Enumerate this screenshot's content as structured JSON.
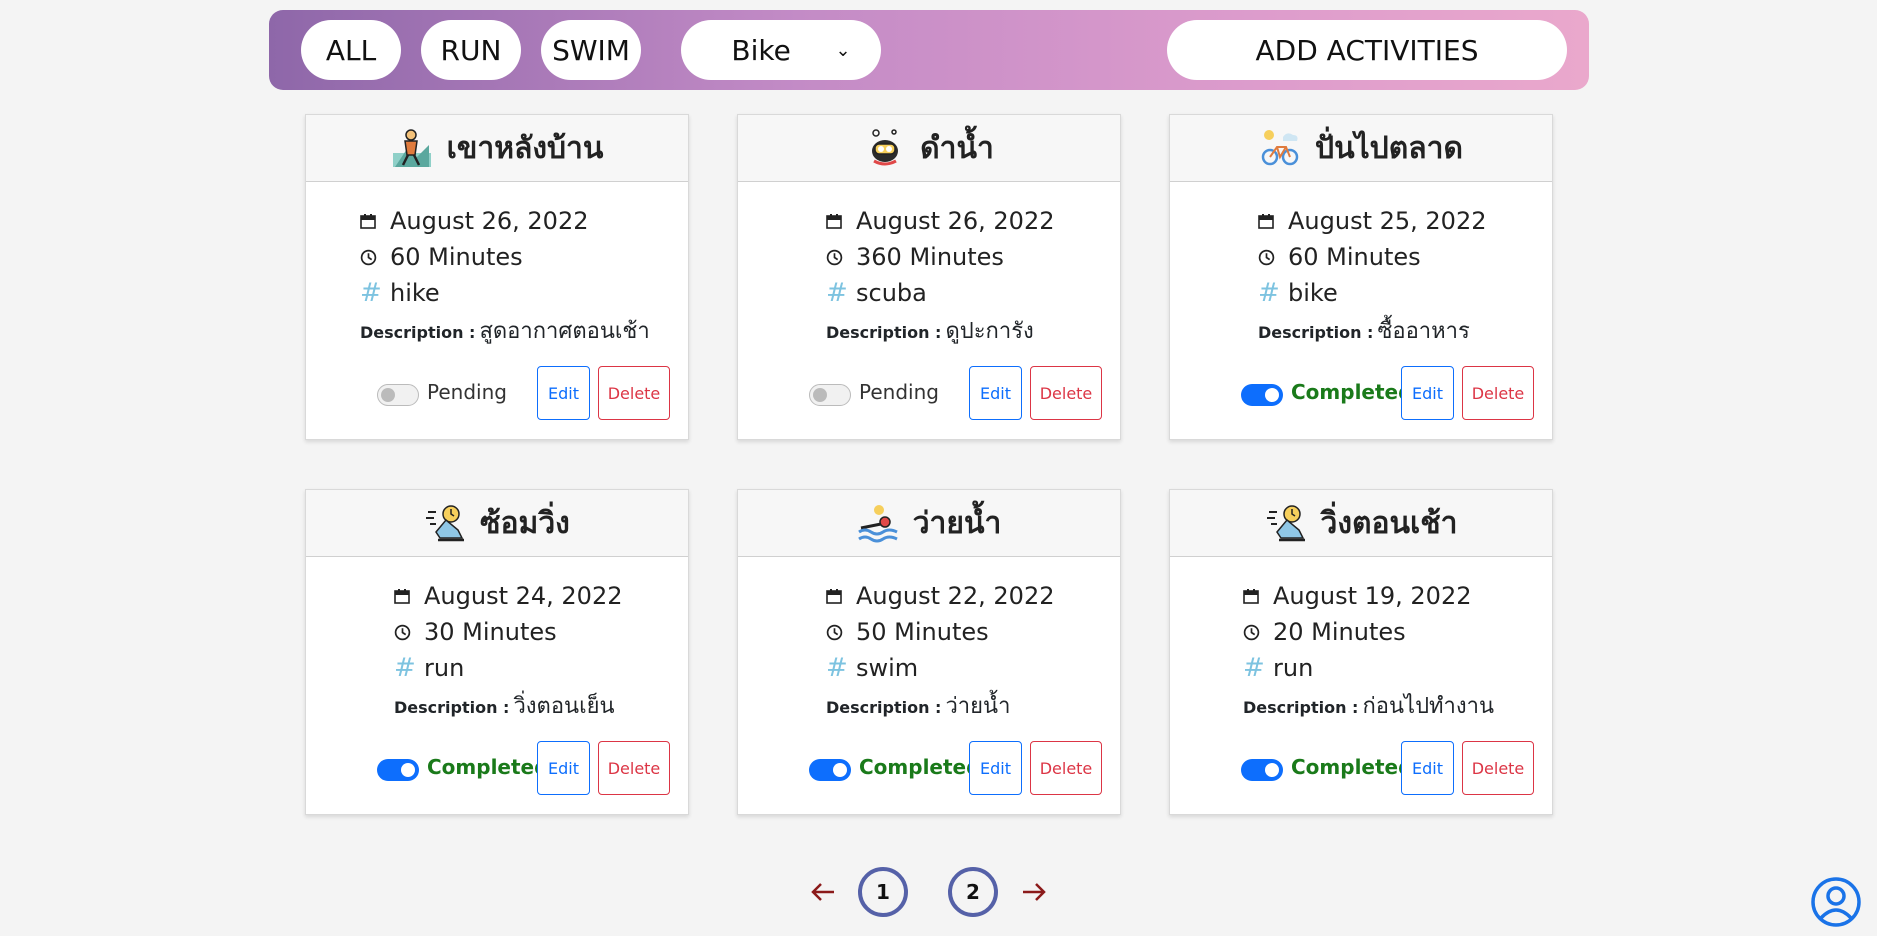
{
  "filters": {
    "all": "ALL",
    "run": "RUN",
    "swim": "SWIM",
    "select_value": "Bike",
    "add": "ADD ACTIVITIES"
  },
  "description_label": "Description :",
  "actions": {
    "edit": "Edit",
    "delete": "Delete"
  },
  "cards": [
    {
      "title": "เขาหลังบ้าน",
      "icon": "hiking-icon",
      "date": "August 26, 2022",
      "duration": "60 Minutes",
      "tag": "hike",
      "description": "สูดอากาศตอนเช้า",
      "status": "Pending",
      "completed": false
    },
    {
      "title": "ดำน้ำ",
      "icon": "scuba-diving-icon",
      "date": "August 26, 2022",
      "duration": "360 Minutes",
      "tag": "scuba",
      "description": "ดูปะการัง",
      "status": "Pending",
      "completed": false
    },
    {
      "title": "ปั่นไปตลาด",
      "icon": "bike-icon",
      "date": "August 25, 2022",
      "duration": "60 Minutes",
      "tag": "bike",
      "description": "ซื้ออาหาร",
      "status": "Completed",
      "completed": true
    },
    {
      "title": "ซ้อมวิ่ง",
      "icon": "running-shoe-icon",
      "date": "August 24, 2022",
      "duration": "30 Minutes",
      "tag": "run",
      "description": "วิ่งตอนเย็น",
      "status": "Completed",
      "completed": true
    },
    {
      "title": "ว่ายน้ำ",
      "icon": "swimming-icon",
      "date": "August 22, 2022",
      "duration": "50 Minutes",
      "tag": "swim",
      "description": "ว่ายน้ำ",
      "status": "Completed",
      "completed": true
    },
    {
      "title": "วิ่งตอนเช้า",
      "icon": "running-shoe-icon",
      "date": "August 19, 2022",
      "duration": "20 Minutes",
      "tag": "run",
      "description": "ก่อนไปทำงาน",
      "status": "Completed",
      "completed": true
    }
  ],
  "pagination": {
    "pages": [
      "1",
      "2"
    ]
  },
  "colors": {
    "accent": "#0d6efd",
    "completed": "#1a7a1a",
    "danger": "#dc3545",
    "pager": "#5561a8"
  }
}
